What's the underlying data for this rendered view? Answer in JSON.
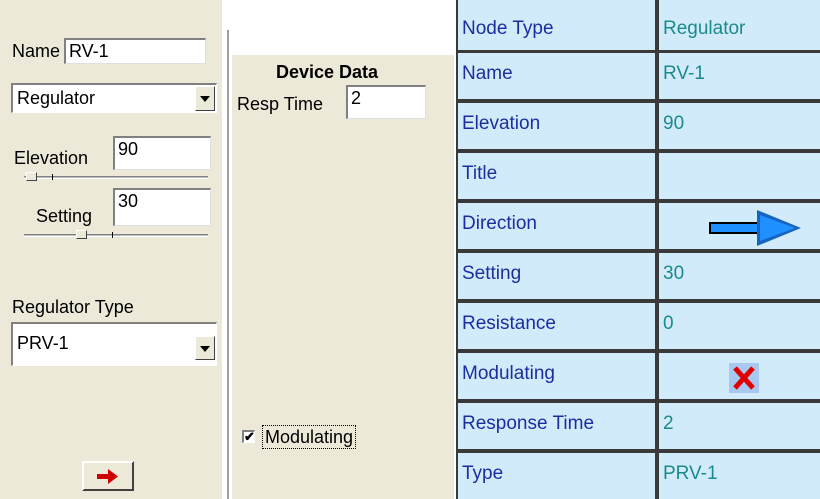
{
  "left_panel": {
    "name_label": "Name",
    "name_value": "RV-1",
    "node_type_selected": "Regulator",
    "elevation_label": "Elevation",
    "elevation_value": "90",
    "setting_label": "Setting",
    "setting_value": "30",
    "regulator_type_label": "Regulator Type",
    "regulator_type_selected": "PRV-1",
    "direction_button_icon": "red-right-arrow-icon"
  },
  "mid_panel": {
    "section_title": "Device Data",
    "resp_time_label": "Resp Time",
    "resp_time_value": "2",
    "modulating_label": "Modulating",
    "modulating_checked": true
  },
  "table": {
    "rows": [
      {
        "property": "Node Type",
        "value": "Regulator"
      },
      {
        "property": "Name",
        "value": "RV-1"
      },
      {
        "property": "Elevation",
        "value": "90"
      },
      {
        "property": "Title",
        "value": ""
      },
      {
        "property": "Direction",
        "value": ""
      },
      {
        "property": "Setting",
        "value": "30"
      },
      {
        "property": "Resistance",
        "value": "0"
      },
      {
        "property": "Modulating",
        "value": ""
      },
      {
        "property": "Response Time",
        "value": "2"
      },
      {
        "property": "Type",
        "value": "PRV-1"
      }
    ],
    "direction_icon": "blue-right-arrow-icon",
    "modulating_icon": "red-x-icon"
  },
  "colors": {
    "cell_bg": "#d2ebfb",
    "label_text": "#1a2ea0",
    "value_text": "#1a8a8a",
    "arrow_blue": "#1e90ff",
    "x_red": "#e00000"
  }
}
